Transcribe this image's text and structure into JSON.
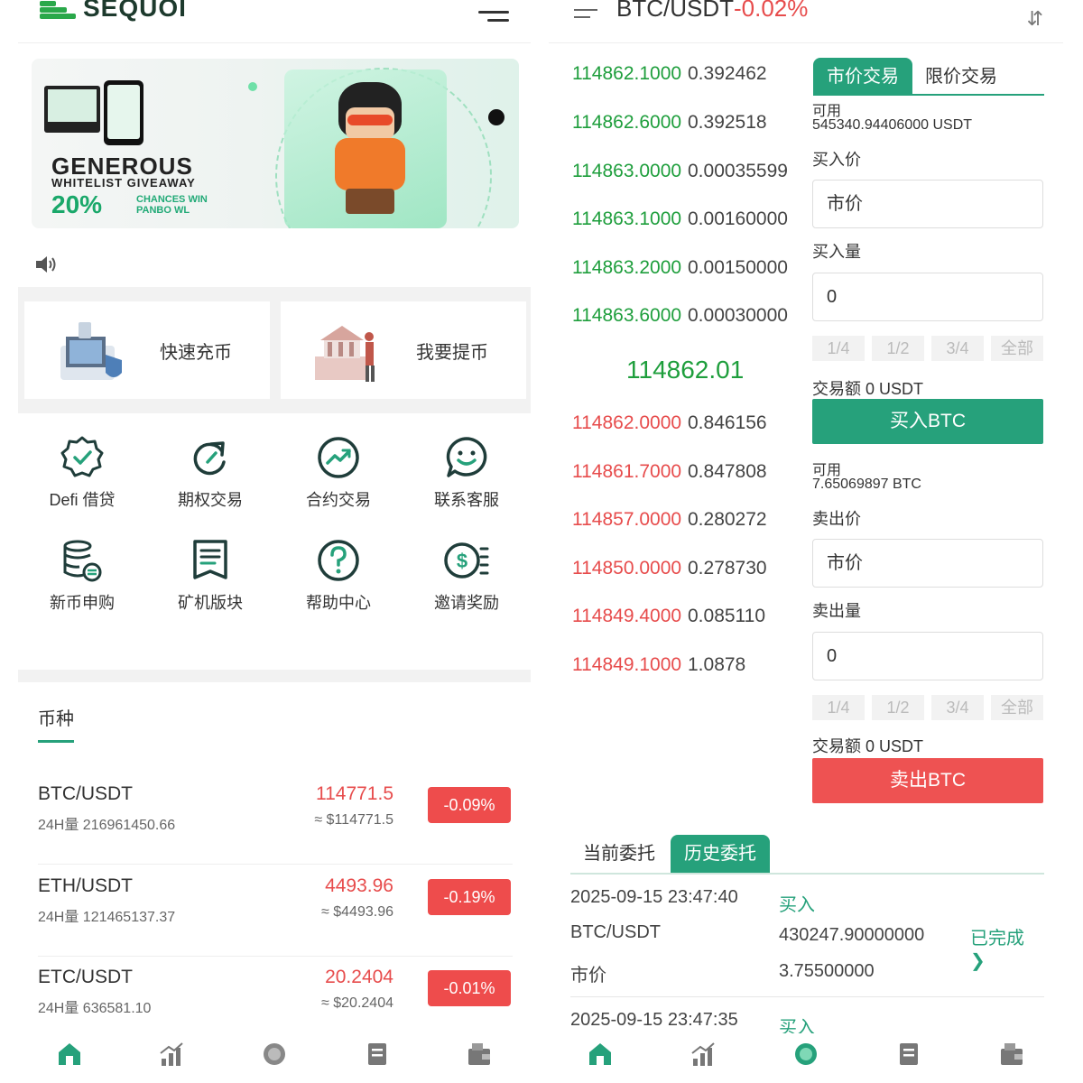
{
  "left": {
    "logo_text": "SEQUOI",
    "banner": {
      "line1": "GENEROUS",
      "line2": "WHITELIST GIVEAWAY",
      "line3": "20%",
      "line4": "CHANCES WIN PANBO WL"
    },
    "quick_actions": [
      {
        "label": "快速充币",
        "icon": "deposit-illustration"
      },
      {
        "label": "我要提币",
        "icon": "withdraw-illustration"
      }
    ],
    "grid": [
      {
        "label": "Defi 借贷",
        "icon": "badge-check-icon"
      },
      {
        "label": "期权交易",
        "icon": "refresh-arrow-icon"
      },
      {
        "label": "合约交易",
        "icon": "trend-chart-icon"
      },
      {
        "label": "联系客服",
        "icon": "smile-chat-icon"
      },
      {
        "label": "新币申购",
        "icon": "coin-database-icon"
      },
      {
        "label": "矿机版块",
        "icon": "document-list-icon"
      },
      {
        "label": "帮助中心",
        "icon": "help-circle-icon"
      },
      {
        "label": "邀请奖励",
        "icon": "dollar-list-icon"
      }
    ],
    "section_title": "币种",
    "coins": [
      {
        "pair": "BTC/USDT",
        "volume": "24H量 216961450.66",
        "price": "114771.5",
        "approx": "≈ $114771.5",
        "change": "-0.09%"
      },
      {
        "pair": "ETH/USDT",
        "volume": "24H量 121465137.37",
        "price": "4493.96",
        "approx": "≈ $4493.96",
        "change": "-0.19%"
      },
      {
        "pair": "ETC/USDT",
        "volume": "24H量 636581.10",
        "price": "20.2404",
        "approx": "≈ $20.2404",
        "change": "-0.01%"
      }
    ],
    "tabbar": [
      "home-icon",
      "chart-icon",
      "trade-icon",
      "orders-icon",
      "wallet-icon"
    ],
    "colors": {
      "accent": "#26a17b",
      "down": "#ee4c4c"
    }
  },
  "right": {
    "title": "BTC/USDT",
    "change": "-0.02%",
    "asks": [
      {
        "price": "114862.1000",
        "qty": "0.392462"
      },
      {
        "price": "114862.6000",
        "qty": "0.392518"
      },
      {
        "price": "114863.0000",
        "qty": "0.00035599"
      },
      {
        "price": "114863.1000",
        "qty": "0.00160000"
      },
      {
        "price": "114863.2000",
        "qty": "0.00150000"
      },
      {
        "price": "114863.6000",
        "qty": "0.00030000"
      }
    ],
    "last_price": "114862.01",
    "bids": [
      {
        "price": "114862.0000",
        "qty": "0.846156"
      },
      {
        "price": "114861.7000",
        "qty": "0.847808"
      },
      {
        "price": "114857.0000",
        "qty": "0.280272"
      },
      {
        "price": "114850.0000",
        "qty": "0.278730"
      },
      {
        "price": "114849.4000",
        "qty": "0.085110"
      },
      {
        "price": "114849.1000",
        "qty": "1.0878"
      }
    ],
    "trade_tabs": {
      "market": "市价交易",
      "limit": "限价交易"
    },
    "buy": {
      "available_label": "可用",
      "available_value": "545340.94406000 USDT",
      "price_label": "买入价",
      "price_value": "市价",
      "amount_label": "买入量",
      "amount_value": "0",
      "total": "交易额 0 USDT",
      "button": "买入BTC"
    },
    "sell": {
      "available_label": "可用",
      "available_value": "7.65069897 BTC",
      "price_label": "卖出价",
      "price_value": "市价",
      "amount_label": "卖出量",
      "amount_value": "0",
      "total": "交易额 0 USDT",
      "button": "卖出BTC"
    },
    "percent_buttons": [
      "1/4",
      "1/2",
      "3/4",
      "全部"
    ],
    "order_tabs": {
      "current": "当前委托",
      "history": "历史委托"
    },
    "orders": [
      {
        "time": "2025-09-15 23:47:40",
        "side": "买入",
        "pair": "BTC/USDT",
        "amount": "430247.90000000",
        "status": "已完成",
        "type": "市价",
        "qty": "3.75500000"
      },
      {
        "time": "2025-09-15 23:47:35",
        "side": "买入"
      }
    ]
  }
}
